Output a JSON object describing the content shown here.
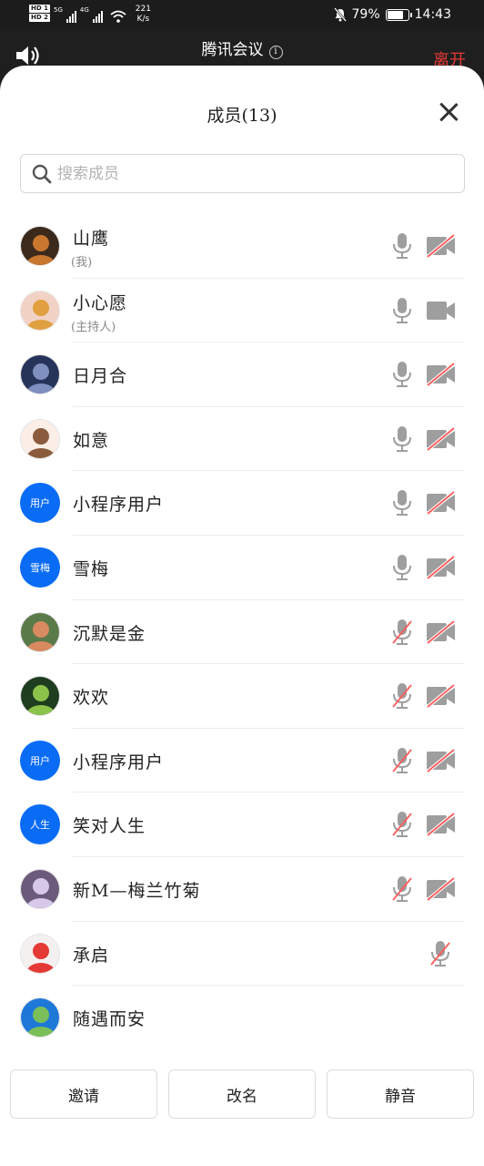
{
  "status": {
    "hd1": "HD 1",
    "hd2": "HD 2",
    "net1": "5G",
    "net2": "4G",
    "speed_value": "221",
    "speed_unit": "K/s",
    "battery": "79%",
    "battery_level": 0.79,
    "time": "14:43"
  },
  "meeting": {
    "title": "腾讯会议",
    "leave_label": "离开"
  },
  "sheet": {
    "title": "成员(13)"
  },
  "search": {
    "placeholder": "搜索成员"
  },
  "members": [
    {
      "name": "山鹰",
      "role": "(我)",
      "avatar": "photo",
      "mic": "on",
      "camera": "off"
    },
    {
      "name": "小心愿",
      "role": "(主持人)",
      "avatar": "photo",
      "mic": "on",
      "camera": "on"
    },
    {
      "name": "日月合",
      "avatar": "photo",
      "mic": "on",
      "camera": "off"
    },
    {
      "name": "如意",
      "avatar": "photo",
      "mic": "on",
      "camera": "off"
    },
    {
      "name": "小程序用户",
      "avatar_text": "用户",
      "mic": "on",
      "camera": "off"
    },
    {
      "name": "雪梅",
      "avatar_text": "雪梅",
      "mic": "on",
      "camera": "off"
    },
    {
      "name": "沉默是金",
      "avatar": "photo",
      "mic": "off",
      "camera": "off"
    },
    {
      "name": "欢欢",
      "avatar": "photo",
      "mic": "off",
      "camera": "off"
    },
    {
      "name": "小程序用户",
      "avatar_text": "用户",
      "mic": "off",
      "camera": "off"
    },
    {
      "name": "笑对人生",
      "avatar_text": "人生",
      "mic": "off",
      "camera": "off"
    },
    {
      "name": "新M—梅兰竹菊",
      "avatar": "photo",
      "mic": "off",
      "camera": "off"
    },
    {
      "name": "承启",
      "avatar": "photo",
      "mic": "off",
      "camera": "none"
    },
    {
      "name": "随遇而安",
      "avatar": "photo",
      "mic": "none",
      "camera": "none"
    }
  ],
  "actions": {
    "invite": "邀请",
    "rename": "改名",
    "mute": "静音"
  },
  "colors": {
    "accent_blue": "#0a6cf5",
    "leave_red": "#e53935",
    "icon_gray": "#9e9e9e",
    "slash_red": "#ff5a5a"
  }
}
